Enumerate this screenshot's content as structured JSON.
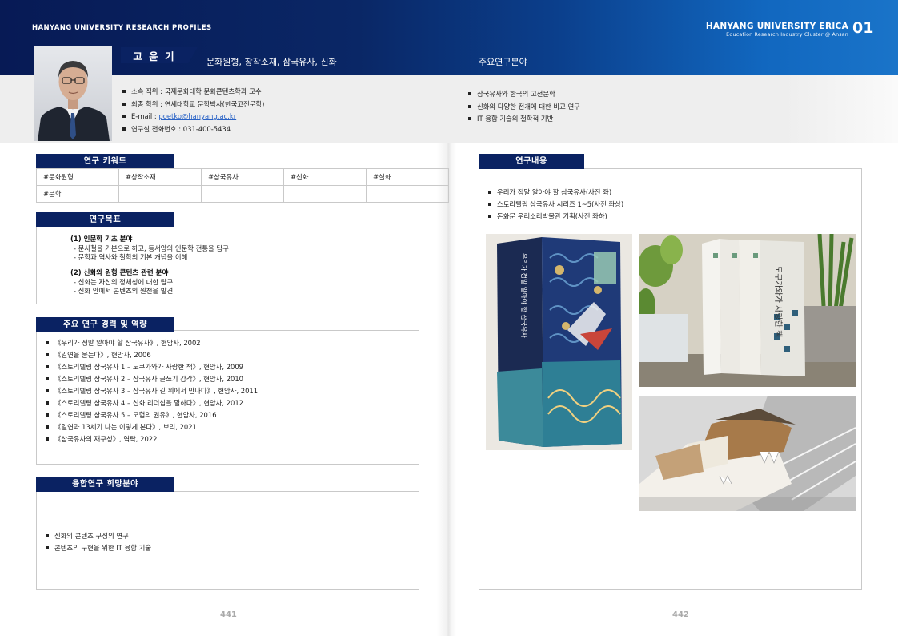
{
  "header": {
    "left_title": "HANYANG UNIVERSITY RESEARCH PROFILES",
    "right_title": "HANYANG UNIVERSITY ERICA",
    "right_subtitle": "Education Research Industry Cluster @ Ansan",
    "chapter": "01"
  },
  "profile": {
    "name": "고 윤 기",
    "keywords_heading": "문화원형, 창작소재, 삼국유사, 신화",
    "position_label": "소속 직위 : 국제문화대학 문화콘텐츠학과 교수",
    "degree_label": "최종 학위 : 연세대학교 문학박사(한국고전문학)",
    "email_prefix": "E-mail : ",
    "email": "poetko@hanyang.ac.kr",
    "phone_label": "연구실 전화번호 : 031-400-5434"
  },
  "major": {
    "title": "주요연구분야",
    "items": [
      "삼국유사와 한국의 고전문학",
      "신화의 다양한 전개에 대한 비교 연구",
      "IT 융합 기술의 철학적 기반"
    ]
  },
  "keywords": {
    "title": "연구 키워드",
    "rows": [
      [
        "#문화원형",
        "#창작소재",
        "#삼국유사",
        "#신화",
        "#설화"
      ],
      [
        "#문학",
        "",
        "",
        "",
        ""
      ]
    ]
  },
  "goals": {
    "title": "연구목표",
    "h1": "(1) 인문학 기초 분야",
    "l1a": "- 문사철을 기본으로 하고, 동서양의 인문학 전통을 탐구",
    "l1b": "- 문학과 역사와 철학의 기본 개념을 이해",
    "h2": "(2) 신화와 원형 콘텐츠 관련 분야",
    "l2a": "- 신화는 자신의 정체성에 대한 탐구",
    "l2b": "- 신화 안에서 콘텐츠의 원천을 발견"
  },
  "career": {
    "title": "주요 연구 경력 및 역량",
    "items": [
      "《우리가 정말 알아야 할 삼국유사》, 현암사, 2002",
      "《일연을 묻는다》, 현암사, 2006",
      "《스토리텔링 삼국유사 1 – 도쿠가와가 사랑한 책》, 현암사, 2009",
      "《스토리텔링 삼국유사 2 – 삼국유사 글쓰기 감각》, 현암사, 2010",
      "《스토리텔링 삼국유사 3 – 삼국유사 길 위에서 만나다》, 현암사, 2011",
      "《스토리텔링 삼국유사 4 – 신화 리더십을 말하다》, 현암사, 2012",
      "《스토리텔링 삼국유사 5 – 모험의 권유》, 현암사, 2016",
      "《일연과 13세기 나는 이렇게 본다》, 보리, 2021",
      "《삼국유사의 재구성》, 역락, 2022"
    ]
  },
  "fusion": {
    "title": "융합연구 희망분야",
    "items": [
      "신화의 콘텐츠 구성의 연구",
      "콘텐츠의 구현을 위한 IT 융합 기술"
    ]
  },
  "research": {
    "title": "연구내용",
    "items": [
      "우리가 정말 알아야 할 삼국유사(사진 좌)",
      "스토리텔링 삼국유사 시리즈 1~5(사진 좌상)",
      "돈화문 우리소리박물관 기획(사진 좌하)"
    ]
  },
  "book_title": "우리가 정말 알아야 할 삼국유사",
  "series_title": "도쿠가와가 사랑한 책",
  "page_numbers": {
    "left": "441",
    "right": "442"
  }
}
